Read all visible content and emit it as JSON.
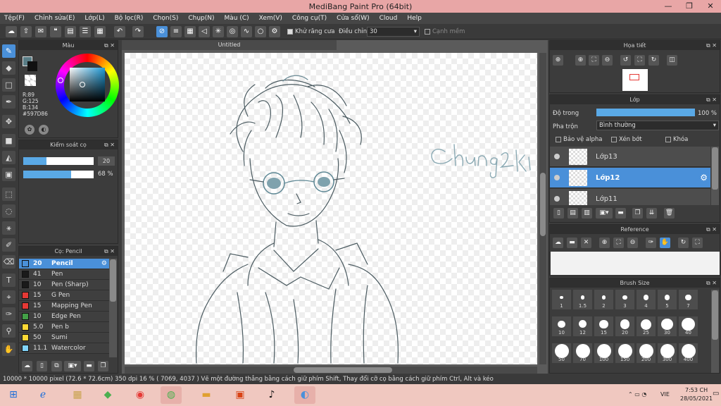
{
  "window": {
    "title": "MediBang Paint Pro (64bit)",
    "minimize": "—",
    "maximize": "❐",
    "close": "✕"
  },
  "menu": [
    "Tệp(F)",
    "Chỉnh sửa(E)",
    "Lớp(L)",
    "Bộ lọc(R)",
    "Chọn(S)",
    "Chụp(N)",
    "Màu (C)",
    "Xem(V)",
    "Công cụ(T)",
    "Cửa sổ(W)",
    "Cloud",
    "Help"
  ],
  "toolbar": {
    "antialias_label": "Khử răng cưa",
    "adjust_label": "Điều chỉnh",
    "adjust_value": "30",
    "smooth_label": "Cạnh mềm"
  },
  "color_panel": {
    "title": "Màu",
    "r": "R:89",
    "g": "G:125",
    "b": "B:134",
    "hex": "#597D86",
    "main_color": "#597D86"
  },
  "brush_control": {
    "title": "Kiểm soát cọ",
    "size_value": "20",
    "opacity_value": "68 %",
    "size_fraction": 0.33,
    "opacity_fraction": 0.68
  },
  "brush_panel": {
    "title": "Cọ: Pencil",
    "items": [
      {
        "size": "20",
        "name": "Pencil",
        "color": "#4a90d9"
      },
      {
        "size": "41",
        "name": "Pen",
        "color": "#1a1a1a"
      },
      {
        "size": "10",
        "name": "Pen (Sharp)",
        "color": "#1a1a1a"
      },
      {
        "size": "15",
        "name": "G Pen",
        "color": "#e53935"
      },
      {
        "size": "15",
        "name": "Mapping Pen",
        "color": "#e53935"
      },
      {
        "size": "10",
        "name": "Edge Pen",
        "color": "#43a047"
      },
      {
        "size": "5.0",
        "name": "Pen b",
        "color": "#fdd835"
      },
      {
        "size": "50",
        "name": "Sumi",
        "color": "#fdd835"
      },
      {
        "size": "11.1",
        "name": "Watercolor",
        "color": "#81d4fa"
      }
    ]
  },
  "canvas": {
    "tab": "Untitled",
    "signature_text": "Chung2k1"
  },
  "navigator": {
    "title": "Họa tiết"
  },
  "layer_panel": {
    "title": "Lớp",
    "opacity_label": "Độ trong",
    "opacity_value": "100 %",
    "opacity_fraction": 1.0,
    "blend_label": "Pha trộn",
    "blend_value": "Bình thường",
    "protect_alpha": "Bảo vệ alpha",
    "clipping": "Xén bớt",
    "lock": "Khóa",
    "layers": [
      "Lớp13",
      "Lớp12",
      "Lớp11"
    ],
    "selected": "Lớp12"
  },
  "reference_panel": {
    "title": "Reference"
  },
  "brush_size_panel": {
    "title": "Brush Size",
    "sizes": [
      "1",
      "1.5",
      "2",
      "3",
      "4",
      "5",
      "7",
      "10",
      "12",
      "15",
      "20",
      "25",
      "30",
      "40",
      "50",
      "70",
      "100",
      "150",
      "200",
      "300",
      "400"
    ]
  },
  "status": {
    "text": "10000 * 10000 pixel   (72.6 * 72.6cm)   350 dpi   16 %   ( 7069, 4037 )   Vẽ một đường thẳng bằng cách giữ phím Shift, Thay đổi cỡ cọ bằng cách giữ phím Ctrl, Alt và kéo"
  },
  "taskbar": {
    "time": "7:53 CH",
    "date": "28/05/2021",
    "lang": "VIE"
  }
}
